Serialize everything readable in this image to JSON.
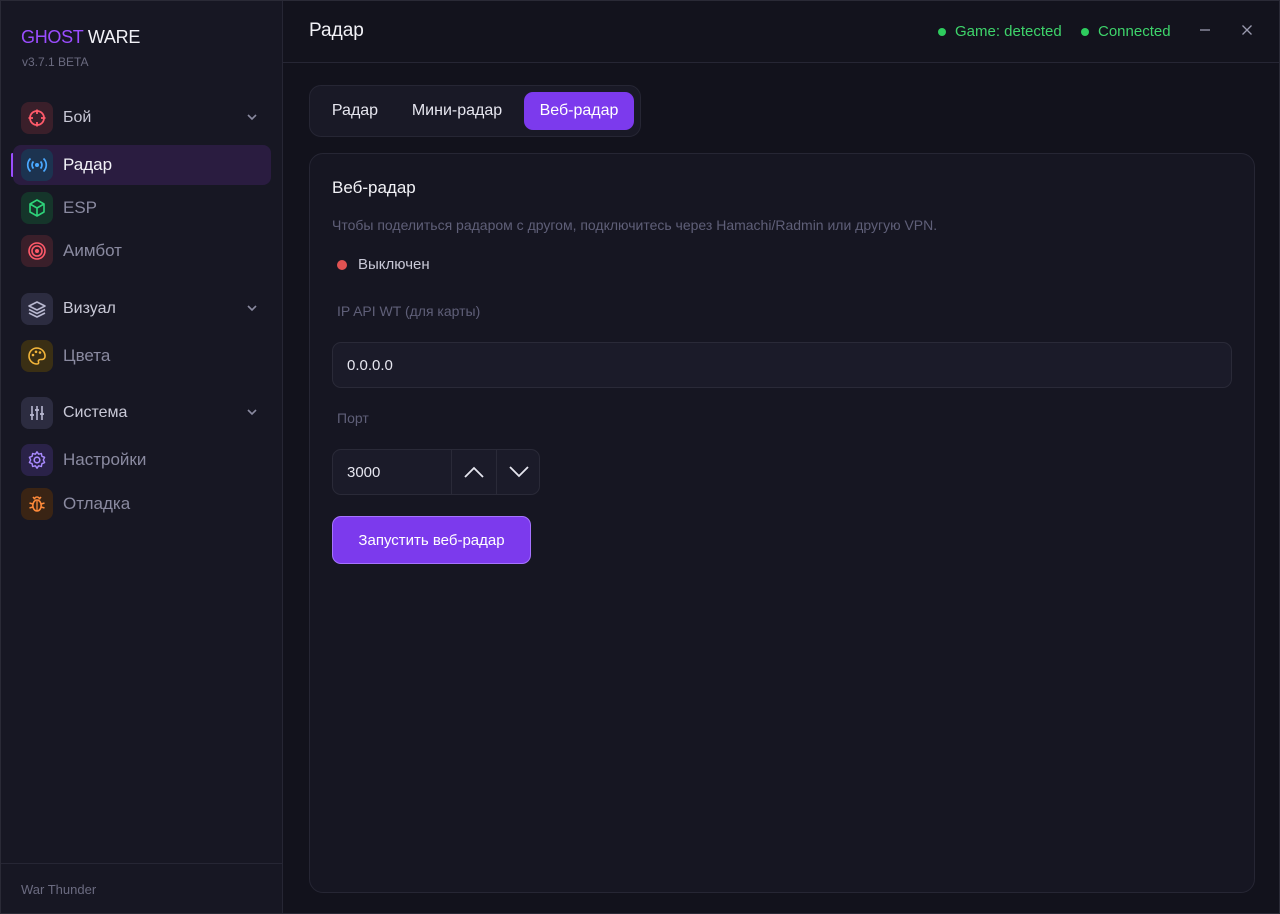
{
  "app": {
    "brand_a": "GHOST",
    "brand_b": " WARE",
    "version": "v3.7.1 BETA",
    "footer": "War Thunder"
  },
  "sidebar": {
    "items": [
      {
        "label": "Бой",
        "icon": "crosshair-icon"
      },
      {
        "label": "Радар",
        "icon": "radar-icon"
      },
      {
        "label": "ESP",
        "icon": "cube-icon"
      },
      {
        "label": "Аимбот",
        "icon": "target-icon"
      },
      {
        "label": "Визуал",
        "icon": "layers-icon"
      },
      {
        "label": "Цвета",
        "icon": "palette-icon"
      },
      {
        "label": "Система",
        "icon": "sliders-icon"
      },
      {
        "label": "Настройки",
        "icon": "gear-icon"
      },
      {
        "label": "Отладка",
        "icon": "bug-icon"
      }
    ]
  },
  "header": {
    "title": "Радар",
    "game_status": "Game: detected",
    "conn_status": "Connected"
  },
  "tabs": [
    {
      "label": "Радар"
    },
    {
      "label": "Мини-радар"
    },
    {
      "label": "Веб-радар"
    }
  ],
  "card": {
    "title": "Веб-радар",
    "description": "Чтобы поделиться радаром с другом, подключитесь через Hamachi/Radmin или другую VPN.",
    "state": "Выключен",
    "ip_label": "IP API WT (для карты)",
    "ip_value": "0.0.0.0",
    "port_label": "Порт",
    "port_value": "3000",
    "start_button": "Запустить веб-радар"
  },
  "colors": {
    "accent": "#7c3aed",
    "brand": "#9b4dff",
    "ok": "#2ecc5e",
    "off": "#e05252"
  }
}
